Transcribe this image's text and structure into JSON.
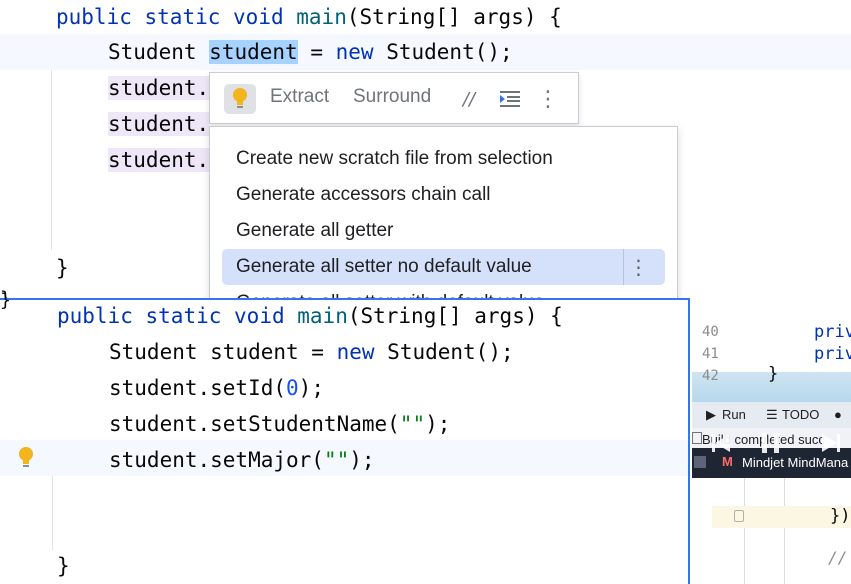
{
  "top_editor": {
    "line1": {
      "kw1": "public",
      "kw2": "static",
      "kw3": "void",
      "method": "main",
      "params": "(String[] args) {"
    },
    "line2": {
      "type": "Student",
      "var": "student",
      "assign": " = ",
      "kw": "new",
      "ctor": " Student();"
    },
    "line3_fragment": "student.",
    "line4_fragment": "student.",
    "line5_fragment": "student.",
    "closing_brace": "}",
    "left_brace": "}"
  },
  "toolbar": {
    "extract_label": "Extract",
    "surround_label": "Surround",
    "comment_symbol": "//",
    "more_symbol": "⋮"
  },
  "context_menu": {
    "items": [
      {
        "label": "Create new scratch file from selection"
      },
      {
        "label": "Generate accessors chain call"
      },
      {
        "label": "Generate all getter"
      },
      {
        "label": "Generate all setter no default value"
      },
      {
        "label": "Generate all setter with default value"
      }
    ],
    "selected_more_symbol": "⋮"
  },
  "bottom_editor": {
    "line1": {
      "kw1": "public",
      "kw2": "static",
      "kw3": "void",
      "method": "main",
      "params": "(String[] args) {"
    },
    "line2": {
      "type": "Student",
      "var": " student = ",
      "kw": "new",
      "ctor": " Student();"
    },
    "line3": {
      "call": "student.setId(",
      "num": "0",
      "end": ");"
    },
    "line4": {
      "call": "student.setStudentName(",
      "str": "\"\"",
      "end": ");"
    },
    "line5": {
      "call": "student.setMajor(",
      "str": "\"\"",
      "end": ");"
    },
    "closing_brace": "}"
  },
  "right_pane": {
    "line_numbers": [
      "40",
      "41",
      "42"
    ],
    "priv1": "priv",
    "priv2": "priv",
    "brace42": "}",
    "run_label": "Run",
    "todo_label": "TODO",
    "build_text": "Build completed succ",
    "taskbar_app": "Mindjet MindMana",
    "close_brace_paren": "})",
    "comment_fragment": "//"
  },
  "colors": {
    "keyword": "#0033b3",
    "method": "#00627a",
    "string": "#067d17",
    "number": "#1750eb",
    "selection": "#a6d2ff",
    "menu_selected": "#d5e1fb",
    "focus_border": "#3574f0"
  }
}
